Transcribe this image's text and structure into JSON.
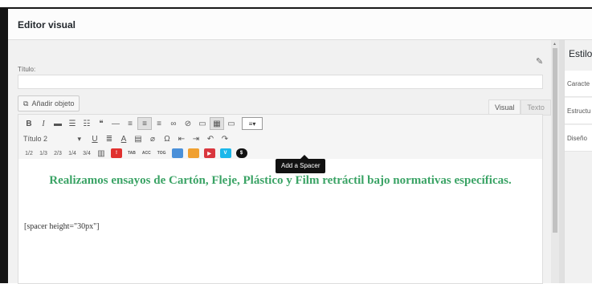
{
  "dialog": {
    "title": "Editor visual"
  },
  "form": {
    "title_label": "Título:",
    "title_value": ""
  },
  "media": {
    "add_label": "Añadir objeto"
  },
  "tabs": [
    {
      "label": "Visual",
      "active": true
    },
    {
      "label": "Texto",
      "active": false
    }
  ],
  "toolbar": {
    "format_select": "Título 2",
    "tooltip": "Add a Spacer",
    "column_buttons": [
      "1/2",
      "1/3",
      "2/3",
      "1/4",
      "3/4"
    ],
    "shortcode_text_buttons": [
      "TAB",
      "ACC",
      "TOG"
    ]
  },
  "content": {
    "heading": "Realizamos ensayos de Cartón, Fleje, Plástico y Film retráctil bajo normativas específicas.",
    "shortcode": "[spacer height=\"30px\"]"
  },
  "sidebar": {
    "title": "Estilo",
    "items": [
      "Caracte",
      "Estructu",
      "Diseño"
    ]
  },
  "colors": {
    "heading_text": "#3aa365",
    "tooltip_bg": "#111111"
  }
}
